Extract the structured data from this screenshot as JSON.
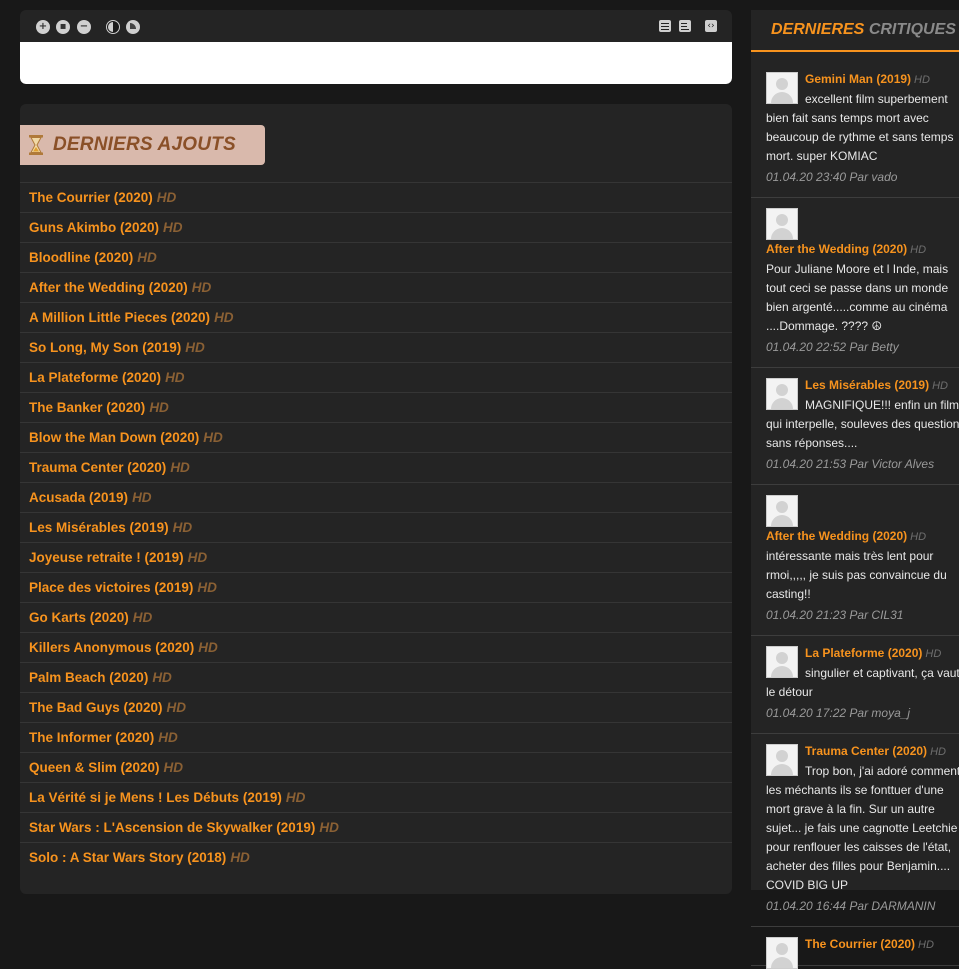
{
  "toolbar": {
    "left_buttons": [
      "plus-icon",
      "stop-icon",
      "minus-icon",
      "contrast-dark-icon",
      "contrast-light-icon"
    ],
    "right_buttons": [
      "list-view-icon",
      "compact-view-icon",
      "expand-arrows-icon"
    ]
  },
  "latest": {
    "title": "DERNIERS AJOUTS",
    "hd_label": "HD",
    "items": [
      {
        "title": "The Courrier (2020)"
      },
      {
        "title": "Guns Akimbo (2020)"
      },
      {
        "title": "Bloodline (2020)"
      },
      {
        "title": "After the Wedding (2020)"
      },
      {
        "title": "A Million Little Pieces (2020)"
      },
      {
        "title": "So Long, My Son (2019)"
      },
      {
        "title": "La Plateforme (2020)"
      },
      {
        "title": "The Banker (2020)"
      },
      {
        "title": "Blow the Man Down (2020)"
      },
      {
        "title": "Trauma Center (2020)"
      },
      {
        "title": "Acusada (2019)"
      },
      {
        "title": "Les Misérables (2019)"
      },
      {
        "title": "Joyeuse retraite ! (2019)"
      },
      {
        "title": "Place des victoires (2019)"
      },
      {
        "title": "Go Karts (2020)"
      },
      {
        "title": "Killers Anonymous (2020)"
      },
      {
        "title": "Palm Beach (2020)"
      },
      {
        "title": "The Bad Guys (2020)"
      },
      {
        "title": "The Informer (2020)"
      },
      {
        "title": "Queen & Slim (2020)"
      },
      {
        "title": "La Vérité si je Mens ! Les Débuts (2019)"
      },
      {
        "title": "Star Wars : L'Ascension de Skywalker (2019)"
      },
      {
        "title": "Solo : A Star Wars Story (2018)"
      }
    ]
  },
  "reviews": {
    "title_part1": "DERNIERES",
    "title_part2": "CRITIQUES",
    "hd_label": "HD",
    "items": [
      {
        "movie": "Gemini Man (2019)",
        "hd": "HD",
        "text": "excellent film superbement bien fait sans temps mort avec beaucoup de rythme et sans temps mort. super KOMIAC",
        "meta": "01.04.20 23:40 Par vado"
      },
      {
        "movie": "After the Wedding (2020)",
        "hd": "HD",
        "text": "Pour Juliane Moore et l Inde, mais tout ceci se passe dans un monde bien argenté.....comme au cinéma ....Dommage. ???? ☮",
        "meta": "01.04.20 22:52 Par Betty"
      },
      {
        "movie": "Les Misérables (2019)",
        "hd": "HD",
        "text": "MAGNIFIQUE!!! enfin un film qui interpelle, souleves des question sans réponses....",
        "meta": "01.04.20 21:53 Par Victor Alves"
      },
      {
        "movie": "After the Wedding (2020)",
        "hd": "HD",
        "text": "intéressante mais très lent pour rmoi,,,,, je suis pas convaincue du casting!!",
        "meta": "01.04.20 21:23 Par CIL31"
      },
      {
        "movie": "La Plateforme (2020)",
        "hd": "HD",
        "text": "singulier et captivant, ça vaut le détour",
        "meta": "01.04.20 17:22 Par moya_j"
      },
      {
        "movie": "Trauma Center (2020)",
        "hd": "HD",
        "text": "Trop bon, j'ai adoré comment les méchants ils se fonttuer d'une mort grave à la fin. Sur un autre sujet... je fais une cagnotte Leetchie pour renflouer les caisses de l'état, acheter des filles pour Benjamin.... COVID BIG UP",
        "meta": "01.04.20 16:44 Par DARMANIN"
      },
      {
        "movie": "The Courrier (2020)",
        "hd": "HD",
        "text": "",
        "meta": ""
      }
    ]
  },
  "colors": {
    "accent": "#f7931e",
    "hd": "#8a6034",
    "panel": "#242424",
    "title_bg": "#d9b9ac"
  }
}
